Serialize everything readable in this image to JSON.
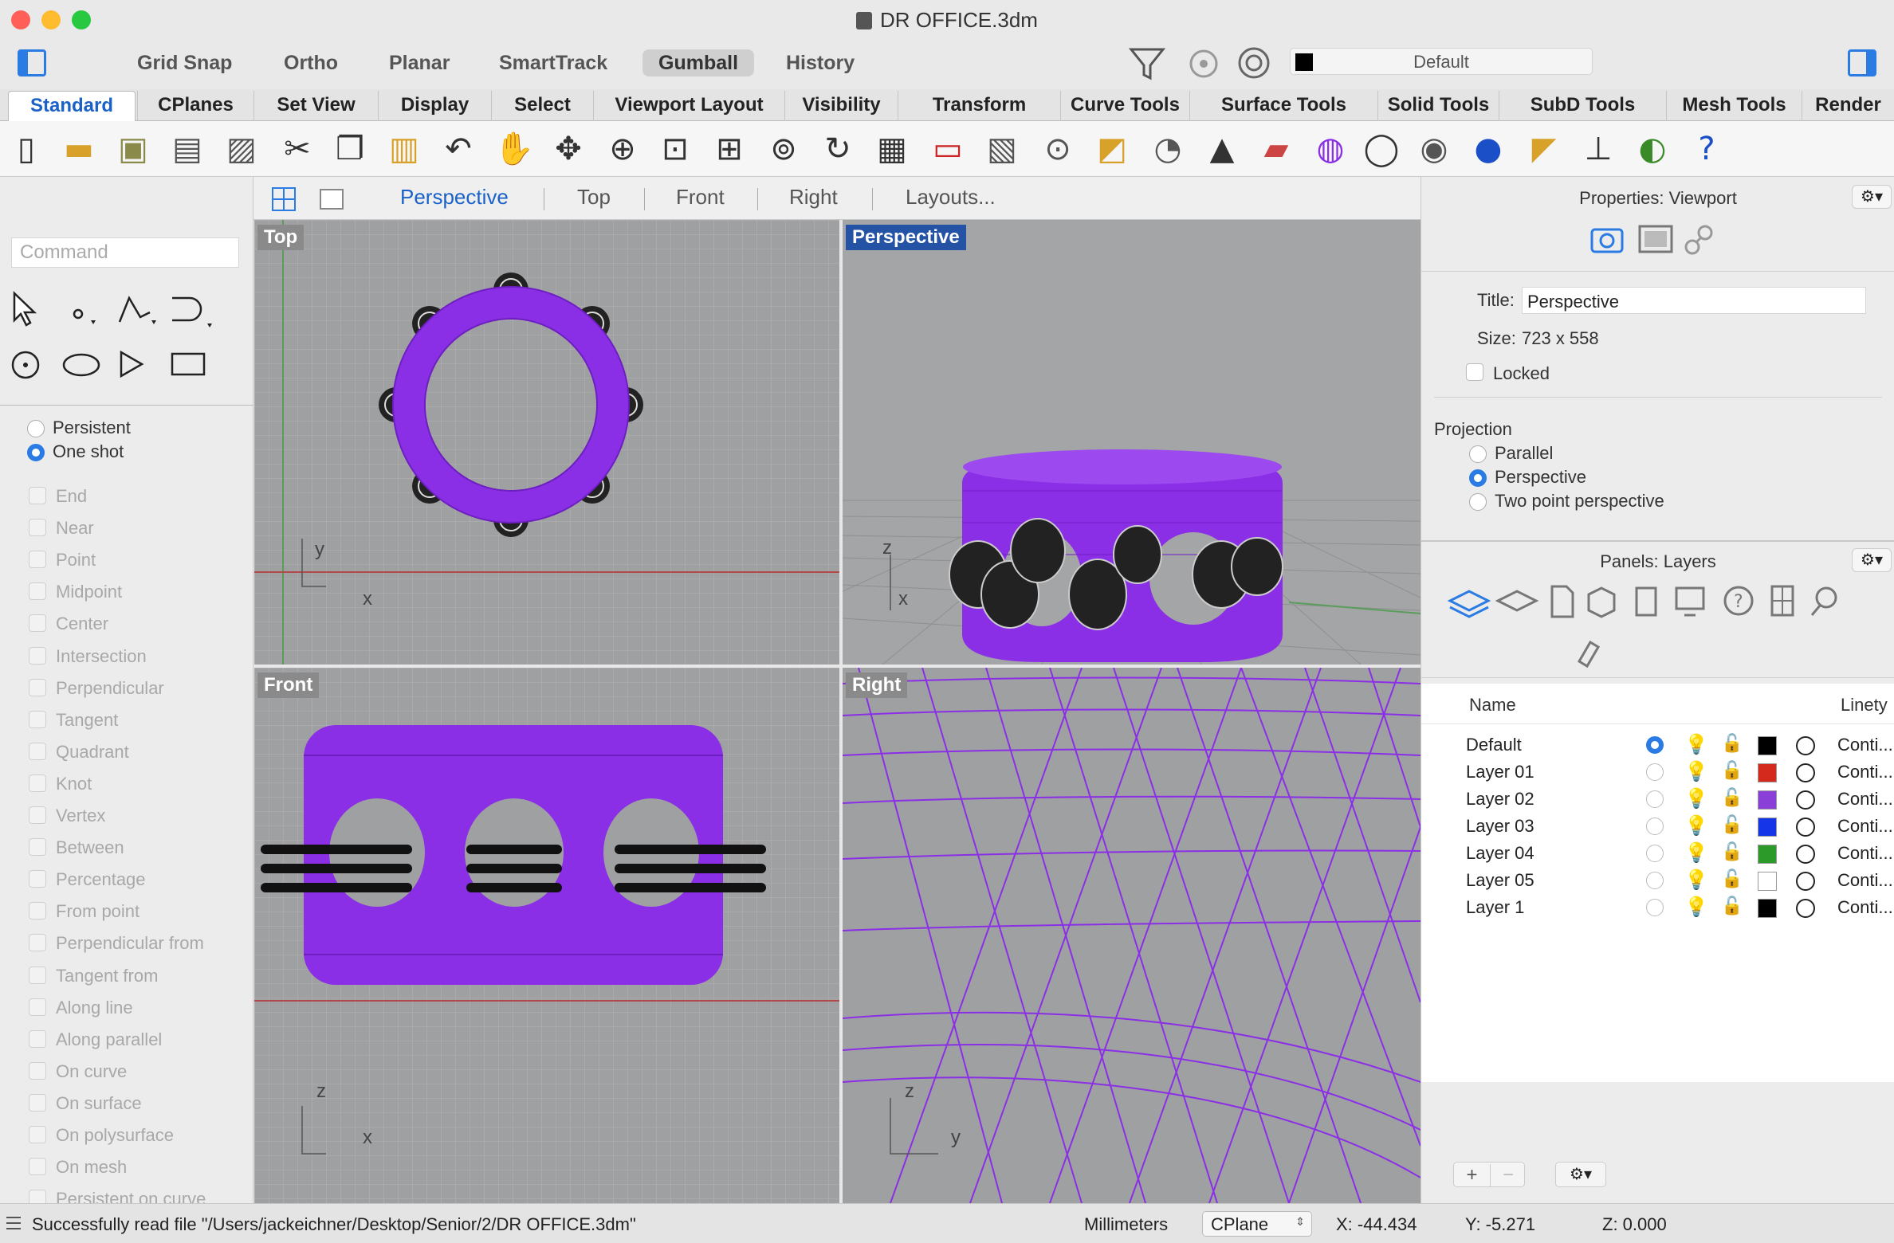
{
  "window": {
    "title": "DR OFFICE.3dm"
  },
  "modes": [
    {
      "label": "Grid Snap",
      "active": false
    },
    {
      "label": "Ortho",
      "active": false
    },
    {
      "label": "Planar",
      "active": false
    },
    {
      "label": "SmartTrack",
      "active": false
    },
    {
      "label": "Gumball",
      "active": true
    },
    {
      "label": "History",
      "active": false
    }
  ],
  "layer_selector": {
    "value": "Default"
  },
  "tabs": [
    "Standard",
    "CPlanes",
    "Set View",
    "Display",
    "Select",
    "Viewport Layout",
    "Visibility",
    "Transform",
    "Curve Tools",
    "Surface Tools",
    "Solid Tools",
    "SubD Tools",
    "Mesh Tools",
    "Render"
  ],
  "active_tab": "Standard",
  "toolbar_icons": [
    "new-file-icon",
    "open-folder-icon",
    "save-icon",
    "print-icon",
    "import-icon",
    "cut-icon",
    "copy-icon",
    "paste-icon",
    "undo-icon",
    "pan-hand-icon",
    "rotate-view-icon",
    "zoom-dynamic-icon",
    "zoom-window-icon",
    "zoom-extents-icon",
    "zoom-selected-icon",
    "rotate-camera-icon",
    "four-viewports-icon",
    "car-icon",
    "grid-plane-icon",
    "cplane-icon",
    "gumball-icon",
    "light-bulb-icon",
    "lock-icon",
    "layer-book-icon",
    "color-wheel-icon",
    "sphere-wire-icon",
    "sphere-shaded-icon",
    "sphere-render-icon",
    "flag-icon",
    "tree-icon",
    "globe-icon",
    "help-icon"
  ],
  "command": {
    "placeholder": "Command"
  },
  "osnap": {
    "mode_persistent": "Persistent",
    "mode_oneshot": "One shot",
    "selected": "One shot",
    "items": [
      "End",
      "Near",
      "Point",
      "Midpoint",
      "Center",
      "Intersection",
      "Perpendicular",
      "Tangent",
      "Quadrant",
      "Knot",
      "Vertex",
      "Between",
      "Percentage",
      "From point",
      "Perpendicular from",
      "Tangent from",
      "Along line",
      "Along parallel",
      "On curve",
      "On surface",
      "On polysurface",
      "On mesh",
      "Persistent on curve"
    ]
  },
  "viewport_tabs": [
    "Perspective",
    "Top",
    "Front",
    "Right",
    "Layouts..."
  ],
  "active_viewport_tab": "Perspective",
  "viewports": {
    "top": {
      "label": "Top",
      "axis_a": "y",
      "axis_b": "x"
    },
    "perspective": {
      "label": "Perspective",
      "axis_a": "z",
      "axis_b": "x"
    },
    "front": {
      "label": "Front",
      "axis_a": "z",
      "axis_b": "x"
    },
    "right": {
      "label": "Right",
      "axis_a": "z",
      "axis_b": "y"
    }
  },
  "properties": {
    "header": "Properties: Viewport",
    "title_label": "Title:",
    "title_value": "Perspective",
    "size_label": "Size:",
    "size_value": "723 x 558",
    "locked_label": "Locked",
    "projection_label": "Projection",
    "projections": [
      "Parallel",
      "Perspective",
      "Two point perspective"
    ],
    "selected_projection": "Perspective"
  },
  "layers_panel": {
    "header": "Panels: Layers",
    "col_name": "Name",
    "col_linetype": "Linety",
    "layers": [
      {
        "name": "Default",
        "current": true,
        "color": "#000000",
        "linetype": "Conti..."
      },
      {
        "name": "Layer 01",
        "current": false,
        "color": "#d42a1e",
        "linetype": "Conti..."
      },
      {
        "name": "Layer 02",
        "current": false,
        "color": "#8a3fd9",
        "linetype": "Conti..."
      },
      {
        "name": "Layer 03",
        "current": false,
        "color": "#1536e8",
        "linetype": "Conti..."
      },
      {
        "name": "Layer 04",
        "current": false,
        "color": "#2c9a28",
        "linetype": "Conti..."
      },
      {
        "name": "Layer 05",
        "current": false,
        "color": "#ffffff",
        "linetype": "Conti..."
      },
      {
        "name": "Layer 1",
        "current": false,
        "color": "#000000",
        "linetype": "Conti..."
      }
    ],
    "add_label": "+",
    "remove_label": "−"
  },
  "status": {
    "message": "Successfully read file \"/Users/jackeichner/Desktop/Senior/2/DR OFFICE.3dm\"",
    "units": "Millimeters",
    "cplane": "CPlane",
    "x": "X: -44.434",
    "y": "Y: -5.271",
    "z": "Z: 0.000"
  },
  "colors": {
    "accent": "#2b7be4",
    "model_purple": "#8b2fe6",
    "viewport_bg": "#9fa0a2",
    "perspective_label": "#2452a4"
  }
}
